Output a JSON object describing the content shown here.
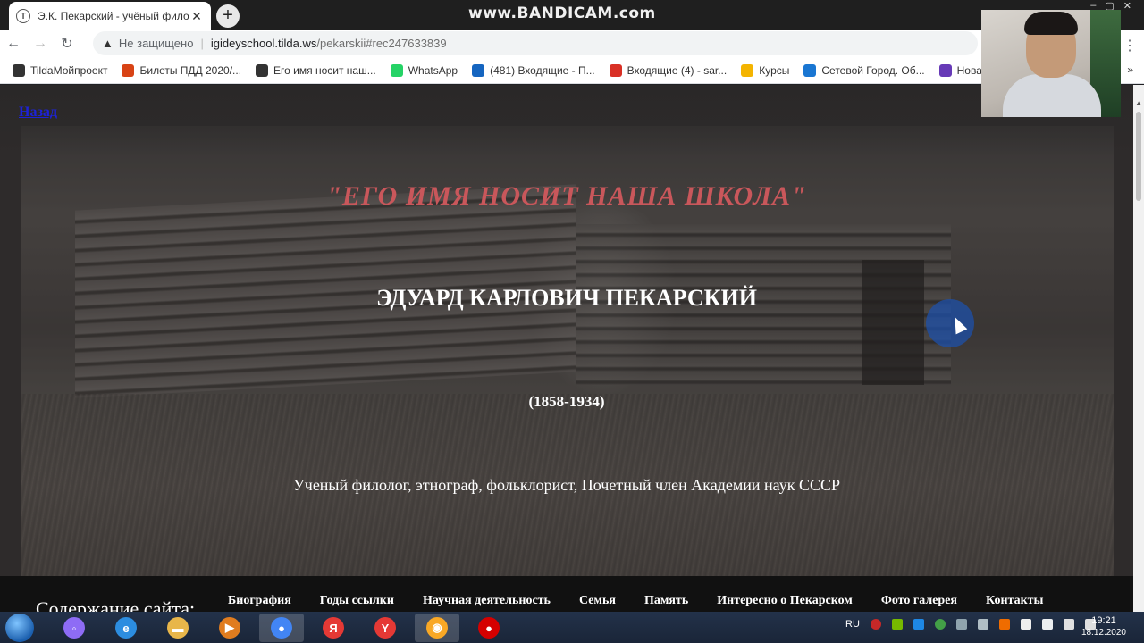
{
  "browser": {
    "tab_title": "Э.К. Пекарский - учёный филол",
    "tab_close": "✕",
    "new_tab": "+",
    "watermark": "www.BANDICAM.com",
    "security_label": "Не защищено",
    "url_host": "igideyschool.tilda.ws",
    "url_path": "/pekarskii#rec247633839"
  },
  "bookmarks": [
    {
      "label": "TildaМойпроект",
      "icon": "tilda-icon",
      "color": "#333333"
    },
    {
      "label": "Билеты ПДД 2020/...",
      "icon": "traffic-icon",
      "color": "#d84315"
    },
    {
      "label": "Его имя носит наш...",
      "icon": "tilda-icon",
      "color": "#333333"
    },
    {
      "label": "WhatsApp",
      "icon": "whatsapp-icon",
      "color": "#25d366"
    },
    {
      "label": "(481) Входящие - П...",
      "icon": "mail-icon",
      "color": "#1565c0"
    },
    {
      "label": "Входящие (4) - sar...",
      "icon": "gmail-icon",
      "color": "#d93025"
    },
    {
      "label": "Курсы",
      "icon": "classroom-icon",
      "color": "#f4b400"
    },
    {
      "label": "Сетевой Город. Об...",
      "icon": "school-icon",
      "color": "#1976d2"
    },
    {
      "label": "Новая фор",
      "icon": "forms-icon",
      "color": "#673ab7"
    }
  ],
  "bookmarks_more": "»",
  "page": {
    "back_link": "Назад",
    "tagline": "\"ЕГО ИМЯ НОСИТ НАША ШКОЛА\"",
    "name": "ЭДУАРД КАРЛОВИЧ ПЕКАРСКИЙ",
    "years": "(1858-1934)",
    "description": "Ученый филолог, этнограф, фольклорист, Почетный член Академии наук СССР",
    "nav_label": "Содержание сайта:",
    "nav_links": [
      "Биография",
      "Годы ссылки",
      "Научная деятельность",
      "Семья",
      "Память",
      "Интересно о Пекарском",
      "Фото галерея",
      "Контакты"
    ]
  },
  "taskbar": {
    "apps": [
      {
        "name": "alice-icon",
        "color": "#8e6cf5",
        "glyph": "◦"
      },
      {
        "name": "ie-icon",
        "color": "#2c8de0",
        "glyph": "e"
      },
      {
        "name": "folder-icon",
        "color": "#e8b64a",
        "glyph": "▬"
      },
      {
        "name": "media-player-icon",
        "color": "#e07c1f",
        "glyph": "▶"
      },
      {
        "name": "chrome-icon",
        "color": "#4285f4",
        "glyph": "●"
      },
      {
        "name": "yandex-icon",
        "color": "#e53935",
        "glyph": "Я"
      },
      {
        "name": "yandex-browser-icon",
        "color": "#e53935",
        "glyph": "Y"
      },
      {
        "name": "security-icon",
        "color": "#f9a825",
        "glyph": "◉"
      },
      {
        "name": "bandicam-icon",
        "color": "#d50000",
        "glyph": "●"
      }
    ],
    "language": "RU",
    "time": "19:21",
    "date": "18.12.2020"
  }
}
